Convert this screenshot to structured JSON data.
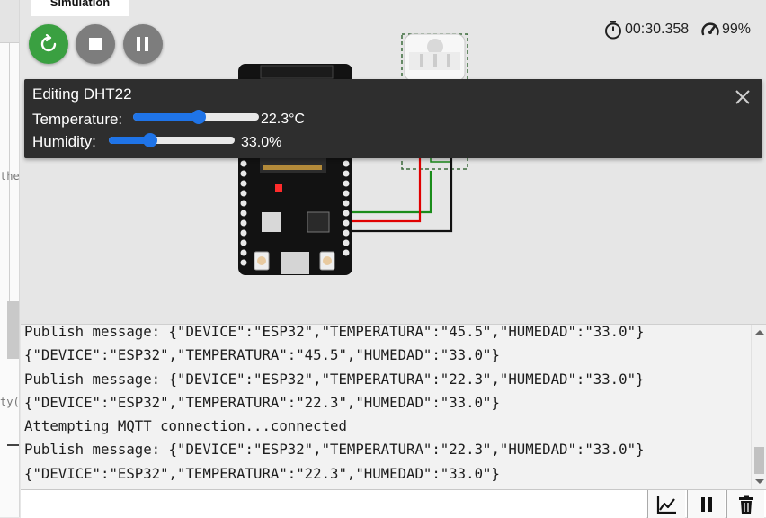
{
  "sim_tab_label": "Simulation",
  "left_code": [
    "the",
    "ty("
  ],
  "timer": "00:30.358",
  "performance": "99%",
  "editor": {
    "title": "Editing DHT22",
    "temperature": {
      "label": "Temperature:",
      "value": "22.3°C",
      "fraction": 0.52
    },
    "humidity": {
      "label": "Humidity:",
      "value": "33.0%",
      "fraction": 0.33
    }
  },
  "console_lines": [
    "Publish message: {\"DEVICE\":\"ESP32\",\"TEMPERATURA\":\"45.5\",\"HUMEDAD\":\"33.0\"}",
    "{\"DEVICE\":\"ESP32\",\"TEMPERATURA\":\"45.5\",\"HUMEDAD\":\"33.0\"}",
    "Publish message: {\"DEVICE\":\"ESP32\",\"TEMPERATURA\":\"22.3\",\"HUMEDAD\":\"33.0\"}",
    "{\"DEVICE\":\"ESP32\",\"TEMPERATURA\":\"22.3\",\"HUMEDAD\":\"33.0\"}",
    "Attempting MQTT connection...connected",
    "Publish message: {\"DEVICE\":\"ESP32\",\"TEMPERATURA\":\"22.3\",\"HUMEDAD\":\"33.0\"}",
    "{\"DEVICE\":\"ESP32\",\"TEMPERATURA\":\"22.3\",\"HUMEDAD\":\"33.0\"}"
  ],
  "serial_input_value": "",
  "icons": {
    "restart": "restart-icon",
    "stop": "stop-icon",
    "pause": "pause-icon",
    "stopwatch": "stopwatch-icon",
    "gauge": "gauge-icon",
    "close": "close-icon",
    "plot": "chart-icon",
    "serial_pause": "pause-icon",
    "clear": "trash-icon"
  },
  "colors": {
    "restart_button": "#3aa041",
    "control_button": "#7d7d7d",
    "slider": "#1f74e8",
    "panel": "#2e2e2e",
    "wire_green": "#1a8c1a",
    "wire_red": "#e00000",
    "wire_black": "#111111"
  }
}
